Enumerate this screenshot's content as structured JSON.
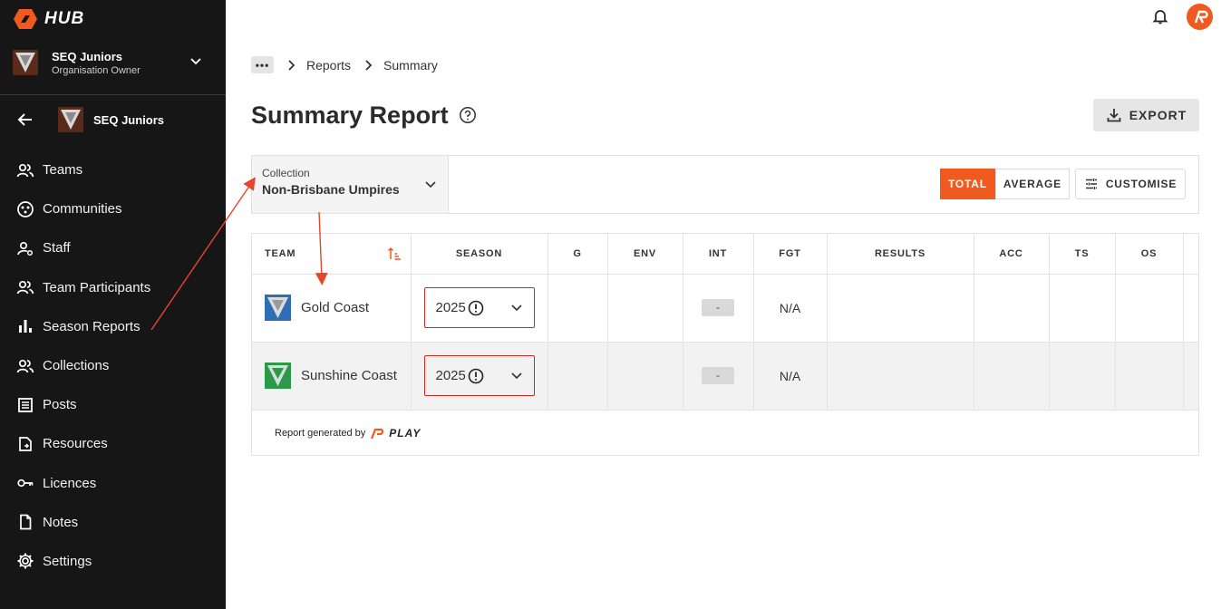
{
  "brand": {
    "logo_text": "HUB"
  },
  "org": {
    "name": "SEQ Juniors",
    "role": "Organisation Owner"
  },
  "sub_org": {
    "name": "SEQ Juniors"
  },
  "nav": [
    {
      "label": "Teams",
      "icon": "people-icon"
    },
    {
      "label": "Communities",
      "icon": "community-icon"
    },
    {
      "label": "Staff",
      "icon": "staff-icon"
    },
    {
      "label": "Team Participants",
      "icon": "people-icon"
    },
    {
      "label": "Season Reports",
      "icon": "bar-chart-icon"
    },
    {
      "label": "Collections",
      "icon": "people-icon"
    },
    {
      "label": "Posts",
      "icon": "posts-icon"
    },
    {
      "label": "Resources",
      "icon": "resources-icon"
    },
    {
      "label": "Licences",
      "icon": "key-icon"
    },
    {
      "label": "Notes",
      "icon": "note-icon"
    },
    {
      "label": "Settings",
      "icon": "gear-icon"
    }
  ],
  "breadcrumb": {
    "items": [
      "Reports",
      "Summary"
    ],
    "more": "•••"
  },
  "page": {
    "title": "Summary Report",
    "export_label": "EXPORT"
  },
  "toolbar": {
    "collection_label": "Collection",
    "collection_value": "Non-Brisbane Umpires",
    "mode_total": "TOTAL",
    "mode_average": "AVERAGE",
    "active_mode": "TOTAL",
    "customise_label": "CUSTOMISE"
  },
  "table": {
    "columns": [
      "TEAM",
      "SEASON",
      "G",
      "ENV",
      "INT",
      "FGT",
      "RESULTS",
      "ACC",
      "TS",
      "OS",
      ""
    ],
    "rows": [
      {
        "team": "Gold Coast",
        "season": "2025",
        "g": "",
        "env": "",
        "int": "-",
        "fgt": "N/A",
        "results": "",
        "acc": "",
        "ts": "",
        "os": "",
        "shield_color": "#2f6db5"
      },
      {
        "team": "Sunshine Coast",
        "season": "2025",
        "g": "",
        "env": "",
        "int": "-",
        "fgt": "N/A",
        "results": "",
        "acc": "",
        "ts": "",
        "os": "",
        "shield_color": "#2a9a4a"
      }
    ]
  },
  "footer": {
    "generated_by": "Report generated by",
    "play_logo_text": "PLAY"
  },
  "colors": {
    "accent": "#f05a1e",
    "sidebar_bg": "#161616",
    "error_border": "#d0281c"
  }
}
